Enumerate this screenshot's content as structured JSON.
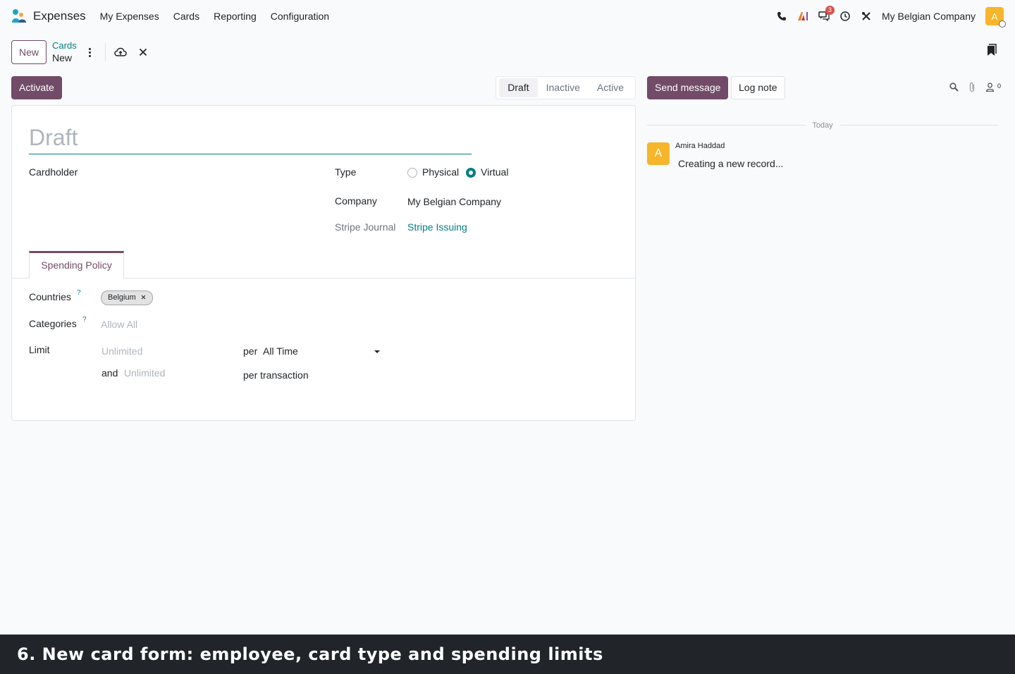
{
  "app": {
    "name": "Expenses"
  },
  "nav": [
    {
      "label": "My Expenses"
    },
    {
      "label": "Cards"
    },
    {
      "label": "Reporting"
    },
    {
      "label": "Configuration"
    }
  ],
  "systray": {
    "messages_badge": "3",
    "company": "My Belgian Company",
    "avatar_letter": "A"
  },
  "control": {
    "new_label": "New",
    "breadcrumb_parent": "Cards",
    "breadcrumb_current": "New"
  },
  "statusbar": {
    "activate_label": "Activate",
    "steps": [
      {
        "label": "Draft",
        "current": true
      },
      {
        "label": "Inactive"
      },
      {
        "label": "Active"
      }
    ]
  },
  "form": {
    "name_placeholder": "Draft",
    "cardholder_label": "Cardholder",
    "type_label": "Type",
    "type_options": [
      {
        "label": "Physical",
        "checked": false
      },
      {
        "label": "Virtual",
        "checked": true
      }
    ],
    "company_label": "Company",
    "company_value": "My Belgian Company",
    "journal_label": "Stripe Journal",
    "journal_value": "Stripe Issuing",
    "tab_label": "Spending Policy",
    "countries_label": "Countries",
    "countries_help": "?",
    "countries_tags": [
      "Belgium"
    ],
    "categories_label": "Categories",
    "categories_help": "?",
    "categories_placeholder": "Allow All",
    "limit_label": "Limit",
    "limit_placeholder": "Unlimited",
    "per_label": "per",
    "period_value": "All Time",
    "and_label": "and",
    "limit2_placeholder": "Unlimited",
    "per_transaction_label": "per transaction"
  },
  "chatter": {
    "send_label": "Send message",
    "log_label": "Log note",
    "followers_count": "0",
    "date_separator": "Today",
    "message": {
      "author": "Amira Haddad",
      "avatar_letter": "A",
      "body": "Creating a new record..."
    }
  },
  "caption": "6. New card form: employee, card type and spending limits"
}
